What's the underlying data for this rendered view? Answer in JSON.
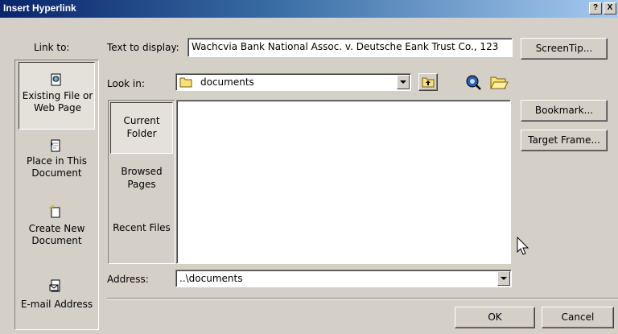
{
  "window": {
    "title": "Insert Hyperlink",
    "help_glyph": "?",
    "close_glyph": "X"
  },
  "link_to": {
    "label": "Link to:",
    "items": [
      {
        "label": "Existing File or Web Page",
        "icon": "web-page-icon",
        "selected": true
      },
      {
        "label": "Place in This Document",
        "icon": "document-place-icon",
        "selected": false
      },
      {
        "label": "Create New Document",
        "icon": "new-document-icon",
        "selected": false
      },
      {
        "label": "E-mail Address",
        "icon": "email-icon",
        "selected": false
      }
    ]
  },
  "text_to_display": {
    "label": "Text to display:",
    "value": "Wachcvia Bank National Assoc. v. Deutsche Eank Trust Co., 123"
  },
  "look_in": {
    "label": "Look in:",
    "value": "documents"
  },
  "browse": {
    "items": [
      {
        "label": "Current Folder",
        "selected": true
      },
      {
        "label": "Browsed Pages",
        "selected": false
      },
      {
        "label": "Recent Files",
        "selected": false
      }
    ]
  },
  "address": {
    "label": "Address:",
    "value": "..\\documents"
  },
  "buttons": {
    "screentip": "ScreenTip...",
    "bookmark": "Bookmark...",
    "target_frame": "Target Frame...",
    "ok": "OK",
    "cancel": "Cancel"
  },
  "colors": {
    "title_start": "#0a246a",
    "title_end": "#a6caf0",
    "face": "#d4d0c8"
  }
}
